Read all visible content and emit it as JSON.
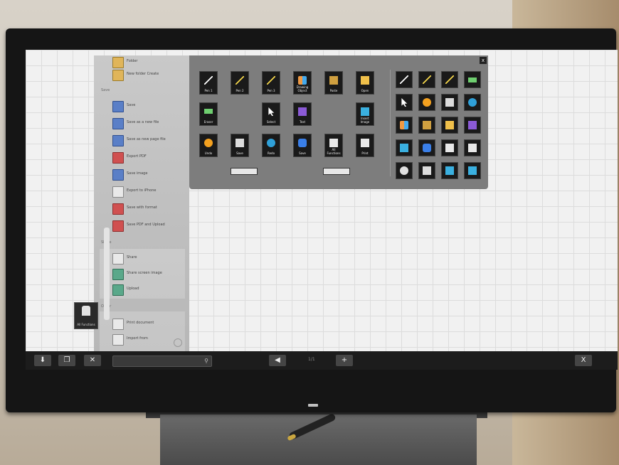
{
  "sidebar": {
    "top_items": [
      "Folder",
      "New folder Create"
    ],
    "section_save": "Save",
    "save_items": [
      "Save",
      "Save as a new file",
      "Save as new page file",
      "Export PDF",
      "Save image",
      "Export to iPhone",
      "Save with format",
      "Save PDF and Upload"
    ],
    "section_share": "Share",
    "share_items": [
      "Share",
      "Share screen image",
      "Upload"
    ],
    "section_other": "Other",
    "other_items": [
      "Print document",
      "Import from"
    ]
  },
  "palette": {
    "close_label": "x",
    "tools": [
      "Pen 1",
      "Pen 2",
      "Pen 3",
      "Drawing Object",
      "Paste",
      "Open",
      "Eraser",
      "Select",
      "Text",
      "Insert Image",
      "Undo",
      "Save",
      "Redo",
      "Save",
      "All Functions",
      "Print"
    ],
    "left_control": "",
    "right_control": ""
  },
  "desktop_icon_label": "All Functions",
  "taskbar": {
    "search_placeholder": "",
    "page_indicator": "1/1",
    "close_label": "X"
  }
}
